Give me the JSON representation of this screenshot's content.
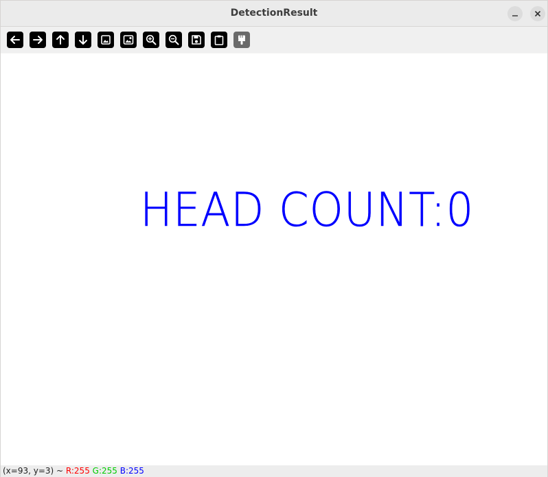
{
  "window": {
    "title": "DetectionResult"
  },
  "toolbar": {
    "buttons": [
      {
        "icon": "arrow-left-icon",
        "label": "Pan left"
      },
      {
        "icon": "arrow-right-icon",
        "label": "Pan right"
      },
      {
        "icon": "arrow-up-icon",
        "label": "Pan up"
      },
      {
        "icon": "arrow-down-icon",
        "label": "Pan down"
      },
      {
        "icon": "image-icon",
        "label": "Zoom x1"
      },
      {
        "icon": "image-fit-icon",
        "label": "Zoom fit"
      },
      {
        "icon": "zoom-in-icon",
        "label": "Zoom in"
      },
      {
        "icon": "zoom-out-icon",
        "label": "Zoom out"
      },
      {
        "icon": "save-icon",
        "label": "Save"
      },
      {
        "icon": "clipboard-icon",
        "label": "Copy"
      },
      {
        "icon": "paint-brush-icon",
        "label": "Properties"
      }
    ]
  },
  "canvas": {
    "text": "HEAD COUNT:0",
    "text_color": "#0000ff",
    "background": "#ffffff"
  },
  "status": {
    "coords": "(x=93, y=3) ~ ",
    "r": "R:255",
    "g": "G:255",
    "b": "B:255"
  }
}
